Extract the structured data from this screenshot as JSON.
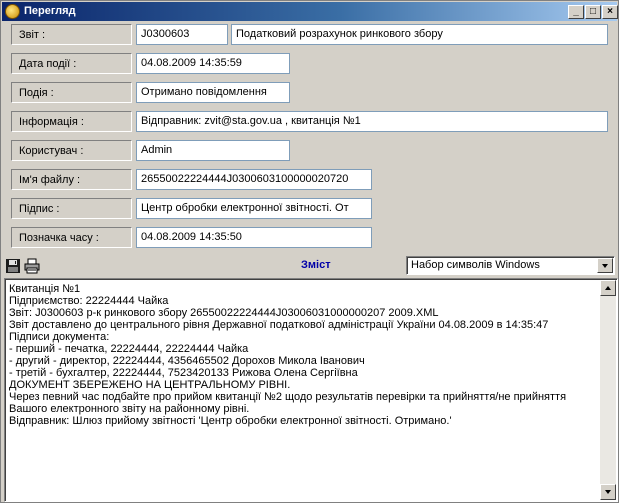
{
  "window": {
    "title": "Перегляд",
    "buttons": {
      "minimize": "_",
      "maximize": "□",
      "close": "×"
    }
  },
  "fields": {
    "report": {
      "label": "Звіт :",
      "code": "J0300603",
      "name": "Податковий розрахунок ринкового збору"
    },
    "event_date": {
      "label": "Дата події :",
      "value": "04.08.2009 14:35:59"
    },
    "event": {
      "label": "Подія :",
      "value": "Отримано повідомлення"
    },
    "info": {
      "label": "Інформація :",
      "value": "Відправник: zvit@sta.gov.ua , квитанція №1"
    },
    "user": {
      "label": "Користувач :",
      "value": "Admin"
    },
    "filename": {
      "label": "Ім'я файлу :",
      "value": "26550022224444J0300603100000020720"
    },
    "signature": {
      "label": "Підпис :",
      "value": "Центр обробки електронної звітності. От"
    },
    "timestamp": {
      "label": "Позначка часу :",
      "value": "04.08.2009 14:35:50"
    }
  },
  "toolbar": {
    "save_icon": "floppy-disk",
    "print_icon": "printer",
    "content_title": "Зміст",
    "charset": "Набор символів Windows"
  },
  "content": {
    "lines": [
      "Квитанція №1",
      "Підприємство: 22224444    Чайка",
      "Звіт: J0300603 р-к ринкового збору              26550022224444J03006031000000207 2009.XML",
      "Звіт доставлено до центрального рівня Державної податкової адміністрації України 04.08.2009 в 14:35:47",
      "Підписи документа:",
      "- перший - печатка, 22224444, 22224444 Чайка",
      "- другий - директор, 22224444, 4356465502 Дорохов Микола Іванович",
      "- третій - бухгалтер, 22224444, 7523420133 Рижова Олена Сергіївна",
      "  ДОКУМЕНТ ЗБЕРЕЖЕНО НА ЦЕНТРАЛЬНОМУ РІВНІ.",
      "  Через певний час подбайте про прийом квитанції №2 щодо результатів перевірки та прийняття/не прийняття",
      "  Вашого електронного звіту на районному рівні.",
      "  Відправник: Шлюз прийому звітності 'Центр обробки електронної звітності. Отримано.'"
    ]
  }
}
